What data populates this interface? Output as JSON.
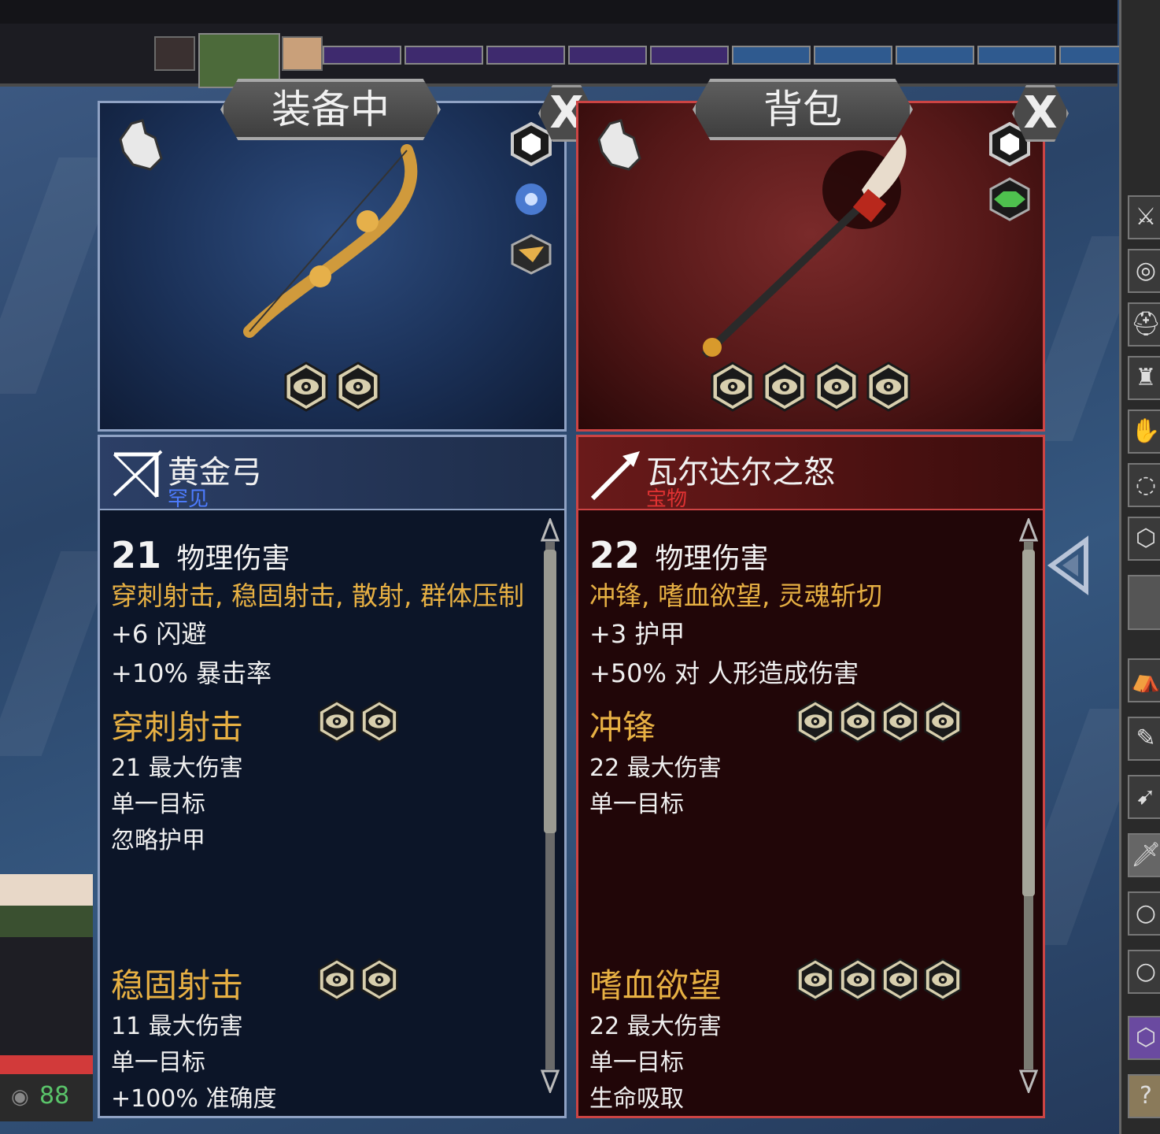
{
  "hud": {
    "eye_count": "88",
    "turn_track": {
      "segment_colors": [
        "#3e2a6e",
        "#3e2a6e",
        "#3e2a6e",
        "#3e2a6e",
        "#3e2a6e",
        "#2f5a8f",
        "#2f5a8f",
        "#2f5a8f",
        "#2f5a8f",
        "#2f5a8f"
      ]
    }
  },
  "equipped": {
    "tab_label": "装备中",
    "close_label": "X",
    "item_name": "黄金弓",
    "item_rarity": "罕见",
    "damage_value": "21",
    "damage_label": "物理伤害",
    "abilities_summary": "穿刺射击, 稳固射击, 散射, 群体压制",
    "stats": [
      "+6 闪避",
      "+10% 暴击率"
    ],
    "abilities": [
      {
        "name": "穿刺射击",
        "eye_cost": 2,
        "details": [
          "21 最大伤害",
          "单一目标",
          "忽略护甲"
        ]
      },
      {
        "name": "稳固射击",
        "eye_cost": 2,
        "details": [
          "11 最大伤害",
          "单一目标",
          "+100% 准确度"
        ]
      }
    ],
    "item_eye_cost": 2,
    "side_icons": [
      "shield-hex-icon",
      "frost-icon",
      "arrow-shot-icon"
    ]
  },
  "backpack": {
    "tab_label": "背包",
    "close_label": "X",
    "item_name": "瓦尔达尔之怒",
    "item_rarity": "宝物",
    "damage_value": "22",
    "damage_label": "物理伤害",
    "abilities_summary": "冲锋, 嗜血欲望, 灵魂斩切",
    "stats": [
      "+3 护甲",
      "+50% 对 人形造成伤害"
    ],
    "abilities": [
      {
        "name": "冲锋",
        "eye_cost": 4,
        "details": [
          "22 最大伤害",
          "单一目标"
        ]
      },
      {
        "name": "嗜血欲望",
        "eye_cost": 4,
        "details": [
          "22 最大伤害",
          "单一目标",
          "生命吸取"
        ]
      }
    ],
    "item_eye_cost": 4,
    "side_icons": [
      "shield-hex-icon",
      "green-gem-icon"
    ]
  },
  "colors": {
    "gold_text": "#e7b043",
    "uncommon_blue": "#4d7cff",
    "artifact_red": "#e03232"
  }
}
